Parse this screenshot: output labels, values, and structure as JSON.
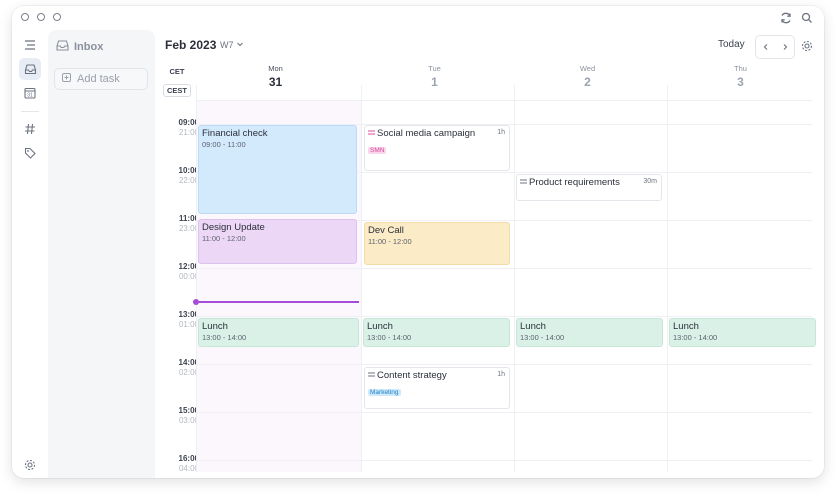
{
  "inbox": {
    "title": "Inbox",
    "add_task_label": "Add task"
  },
  "header": {
    "month": "Feb 2023",
    "week": "W7",
    "today_label": "Today"
  },
  "timezones": {
    "primary": "CET",
    "secondary": "CEST"
  },
  "days": [
    {
      "name": "Mon",
      "num": "31"
    },
    {
      "name": "Tue",
      "num": "1"
    },
    {
      "name": "Wed",
      "num": "2"
    },
    {
      "name": "Thu",
      "num": "3"
    }
  ],
  "times": [
    {
      "main": "09:00",
      "alt": "21:00"
    },
    {
      "main": "10:00",
      "alt": "22:00"
    },
    {
      "main": "11:00",
      "alt": "23:00"
    },
    {
      "main": "12:00",
      "alt": "00:00"
    },
    {
      "main": "13:00",
      "alt": "01:00"
    },
    {
      "main": "14:00",
      "alt": "02:00"
    },
    {
      "main": "15:00",
      "alt": "03:00"
    },
    {
      "main": "16:00",
      "alt": "04:00"
    }
  ],
  "events": {
    "financial_check": {
      "title": "Financial check",
      "time": "09:00 - 11:00"
    },
    "design_update": {
      "title": "Design Update",
      "time": "11:00 - 12:00"
    },
    "dev_call": {
      "title": "Dev Call",
      "time": "11:00 - 12:00"
    },
    "lunch_mon": {
      "title": "Lunch",
      "time": "13:00 - 14:00"
    },
    "lunch_tue": {
      "title": "Lunch",
      "time": "13:00 - 14:00"
    },
    "lunch_wed": {
      "title": "Lunch",
      "time": "13:00 - 14:00"
    },
    "lunch_thu": {
      "title": "Lunch",
      "time": "13:00 - 14:00"
    }
  },
  "tasks": {
    "social_media": {
      "title": "Social media campaign",
      "duration": "1h",
      "tag": "SMN"
    },
    "product_req": {
      "title": "Product requirements",
      "duration": "30m"
    },
    "content_strategy": {
      "title": "Content strategy",
      "duration": "1h",
      "tag": "Marketing"
    }
  },
  "colors": {
    "event_blue": "#d3e9fc",
    "event_purple": "#ecd7f6",
    "event_yellow": "#fbebc6",
    "event_green": "#daf1e7",
    "now_line": "#a54cd8",
    "tag_pink": "#f9d6ec",
    "tag_blue": "#cde9fb"
  }
}
